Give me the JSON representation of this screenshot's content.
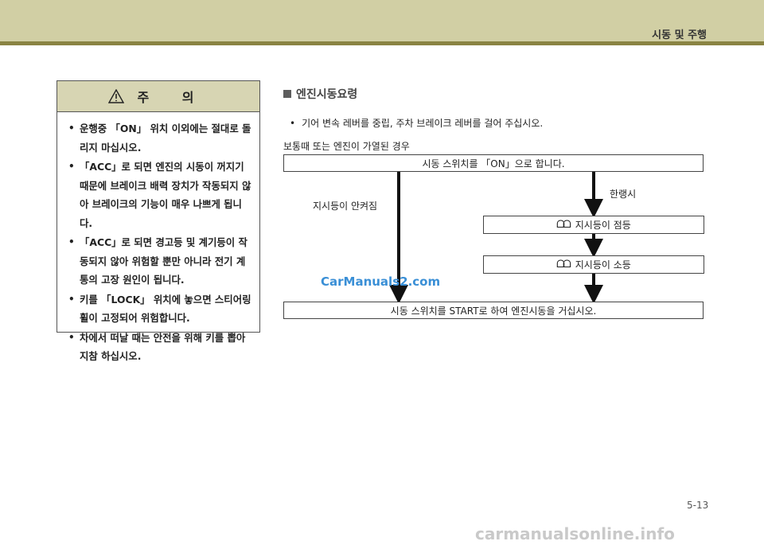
{
  "header": {
    "section_title": "시동 및 주행"
  },
  "caution": {
    "title": "주 의",
    "items": [
      "운행중 「ON」 위치 이외에는 절대로 돌리지 마십시오.",
      "「ACC」로 되면 엔진의 시동이 꺼지기 때문에 브레이크 배력 장치가 작동되지 않아 브레이크의 기능이 매우 나쁘게 됩니다.",
      "「ACC」로 되면 경고등 및 계기등이 작동되지 않아 위험할 뿐만 아니라 전기 계통의 고장 원인이 됩니다.",
      "키를 「LOCK」 위치에 놓으면 스티어링 휠이 고정되어 위험합니다.",
      "차에서 떠날 때는 안전을 위해 키를 뽑아 지참 하십시오."
    ]
  },
  "main": {
    "heading": "엔진시동요령",
    "bullet": "기어 변속 레버를 중립, 주차 브레이크 레버를 걸어 주십시오.",
    "condition": "보통때 또는 엔진이 가열된 경우"
  },
  "flow": {
    "step_switch_on": "시동 스위치를 「ON」으로 합니다.",
    "label_not_lit": "지시등이 안켜짐",
    "label_cold": "한랭시",
    "lamp_on": "지시등이 점등",
    "lamp_off": "지시등이 소등",
    "coil_symbol": "ᗝᗝ",
    "step_start": "시동 스위치를 START로 하여 엔진시동을 거십시오."
  },
  "watermark_mid": "CarManuals2.com",
  "page_number": "5-13",
  "footer_watermark": "carmanualsonline.info",
  "colors": {
    "header_band": "#d1cfa4",
    "header_rule": "#8a8443",
    "watermark": "#3a8fd6"
  }
}
